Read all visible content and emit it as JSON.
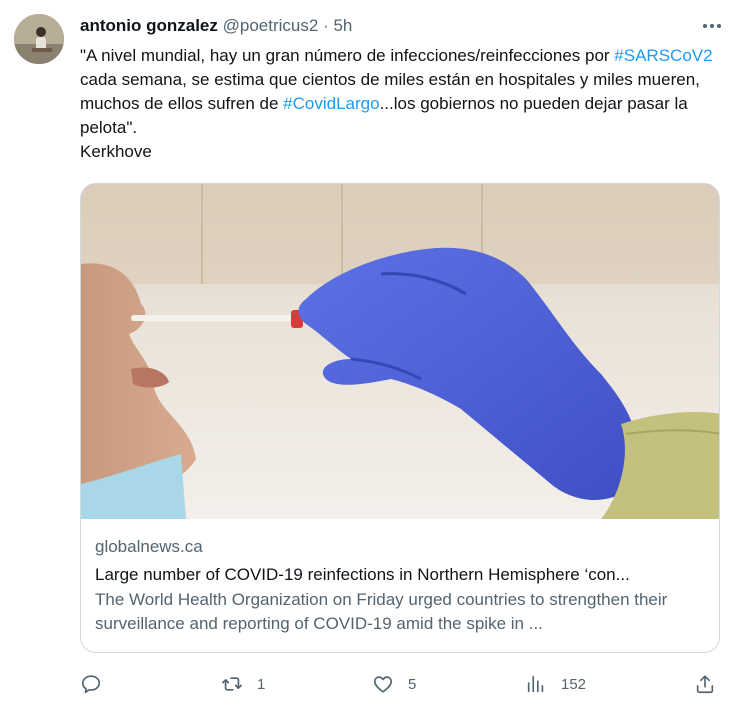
{
  "tweet": {
    "author_name": "antonio gonzalez",
    "handle": "@poetricus2",
    "separator": "·",
    "time": "5h",
    "text_parts": [
      "\"A nivel mundial, hay un gran número de infecciones/reinfecciones por ",
      "#SARSCoV2",
      " cada semana, se estima que cientos de miles están en hospitales y miles mueren, muchos de ellos sufren de ",
      "#CovidLargo",
      "...los gobiernos no pueden dejar pasar la pelota\".",
      "Kerkhove"
    ]
  },
  "card": {
    "domain": "globalnews.ca",
    "title": "Large number of COVID-19 reinfections in Northern Hemisphere ‘con...",
    "description": "The World Health Organization on Friday urged countries to strengthen their surveillance and reporting of COVID-19 amid the spike in ..."
  },
  "actions": {
    "reply_count": "",
    "retweet_count": "1",
    "like_count": "5",
    "views_count": "152"
  },
  "icons": {
    "more": "more-dots-icon",
    "reply": "reply-icon",
    "retweet": "retweet-icon",
    "like": "heart-icon",
    "views": "views-icon",
    "share": "share-icon"
  },
  "colors": {
    "hashtag": "#1d9bf0",
    "secondary_text": "#536471",
    "border": "#cfd9de",
    "glove": "#5064d8"
  }
}
